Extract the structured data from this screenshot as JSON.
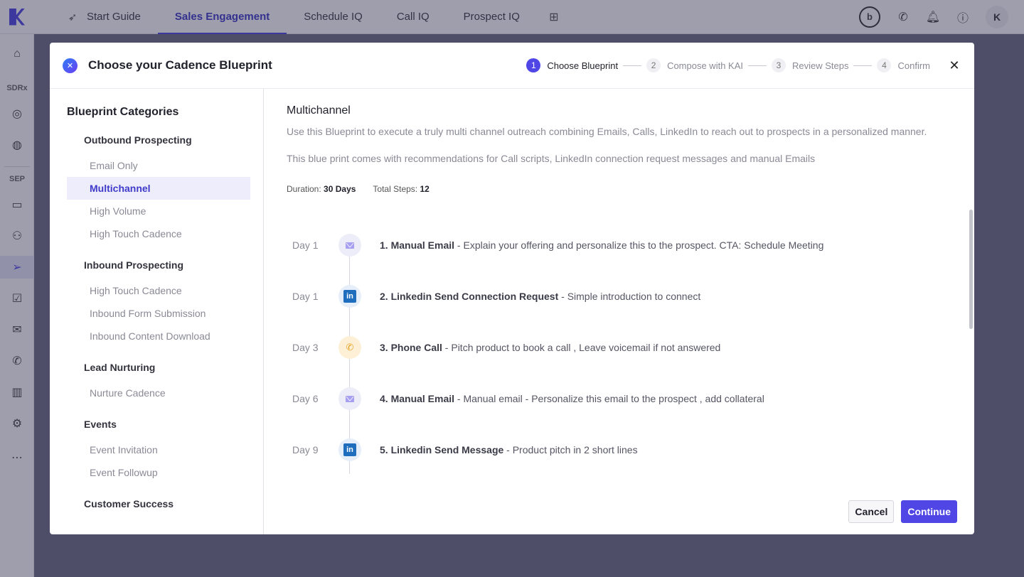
{
  "topnav": {
    "tabs": [
      {
        "label": "Start Guide",
        "icon": "rocket-icon"
      },
      {
        "label": "Sales Engagement"
      },
      {
        "label": "Schedule IQ"
      },
      {
        "label": "Call IQ"
      },
      {
        "label": "Prospect IQ"
      }
    ],
    "avatar_initial": "K",
    "brand_color": "#4f46e5"
  },
  "rail": {
    "sdrx_label": "SDRx",
    "sep_label": "SEP"
  },
  "modal": {
    "title": "Choose your Cadence Blueprint",
    "steps": [
      {
        "num": "1",
        "label": "Choose Blueprint"
      },
      {
        "num": "2",
        "label": "Compose with KAI"
      },
      {
        "num": "3",
        "label": "Review Steps"
      },
      {
        "num": "4",
        "label": "Confirm"
      }
    ],
    "categories_heading": "Blueprint Categories",
    "groups": [
      {
        "title": "Outbound Prospecting",
        "items": [
          "Email Only",
          "Multichannel",
          "High Volume",
          "High Touch Cadence"
        ]
      },
      {
        "title": "Inbound Prospecting",
        "items": [
          "High Touch Cadence",
          "Inbound Form Submission",
          "Inbound Content Download"
        ]
      },
      {
        "title": "Lead Nurturing",
        "items": [
          "Nurture Cadence"
        ]
      },
      {
        "title": "Events",
        "items": [
          "Event Invitation",
          "Event Followup"
        ]
      },
      {
        "title": "Customer Success",
        "items": []
      }
    ],
    "detail": {
      "title": "Multichannel",
      "description": "Use this Blueprint to execute a truly multi channel outreach combining Emails, Calls, LinkedIn to reach out to prospects in a personalized manner.",
      "description2": "This blue print comes with recommendations for Call scripts, LinkedIn connection request messages and manual Emails",
      "duration_label": "Duration:",
      "duration_value": "30 Days",
      "total_steps_label": "Total Steps:",
      "total_steps_value": "12",
      "steps": [
        {
          "day": "Day 1",
          "type": "email",
          "name": "1. Manual Email",
          "desc": " - Explain your offering and personalize this to the prospect. CTA: Schedule Meeting"
        },
        {
          "day": "Day 1",
          "type": "linkedin",
          "name": "2. Linkedin Send Connection Request",
          "desc": " - Simple introduction to connect"
        },
        {
          "day": "Day 3",
          "type": "phone",
          "name": "3. Phone Call",
          "desc": " - Pitch product to book a call , Leave voicemail if not answered"
        },
        {
          "day": "Day 6",
          "type": "email",
          "name": "4. Manual Email",
          "desc": " - Manual email - Personalize this email to the prospect , add collateral"
        },
        {
          "day": "Day 9",
          "type": "linkedin",
          "name": "5. Linkedin Send Message",
          "desc": " - Product pitch in 2 short lines"
        }
      ]
    },
    "cancel_label": "Cancel",
    "continue_label": "Continue"
  }
}
